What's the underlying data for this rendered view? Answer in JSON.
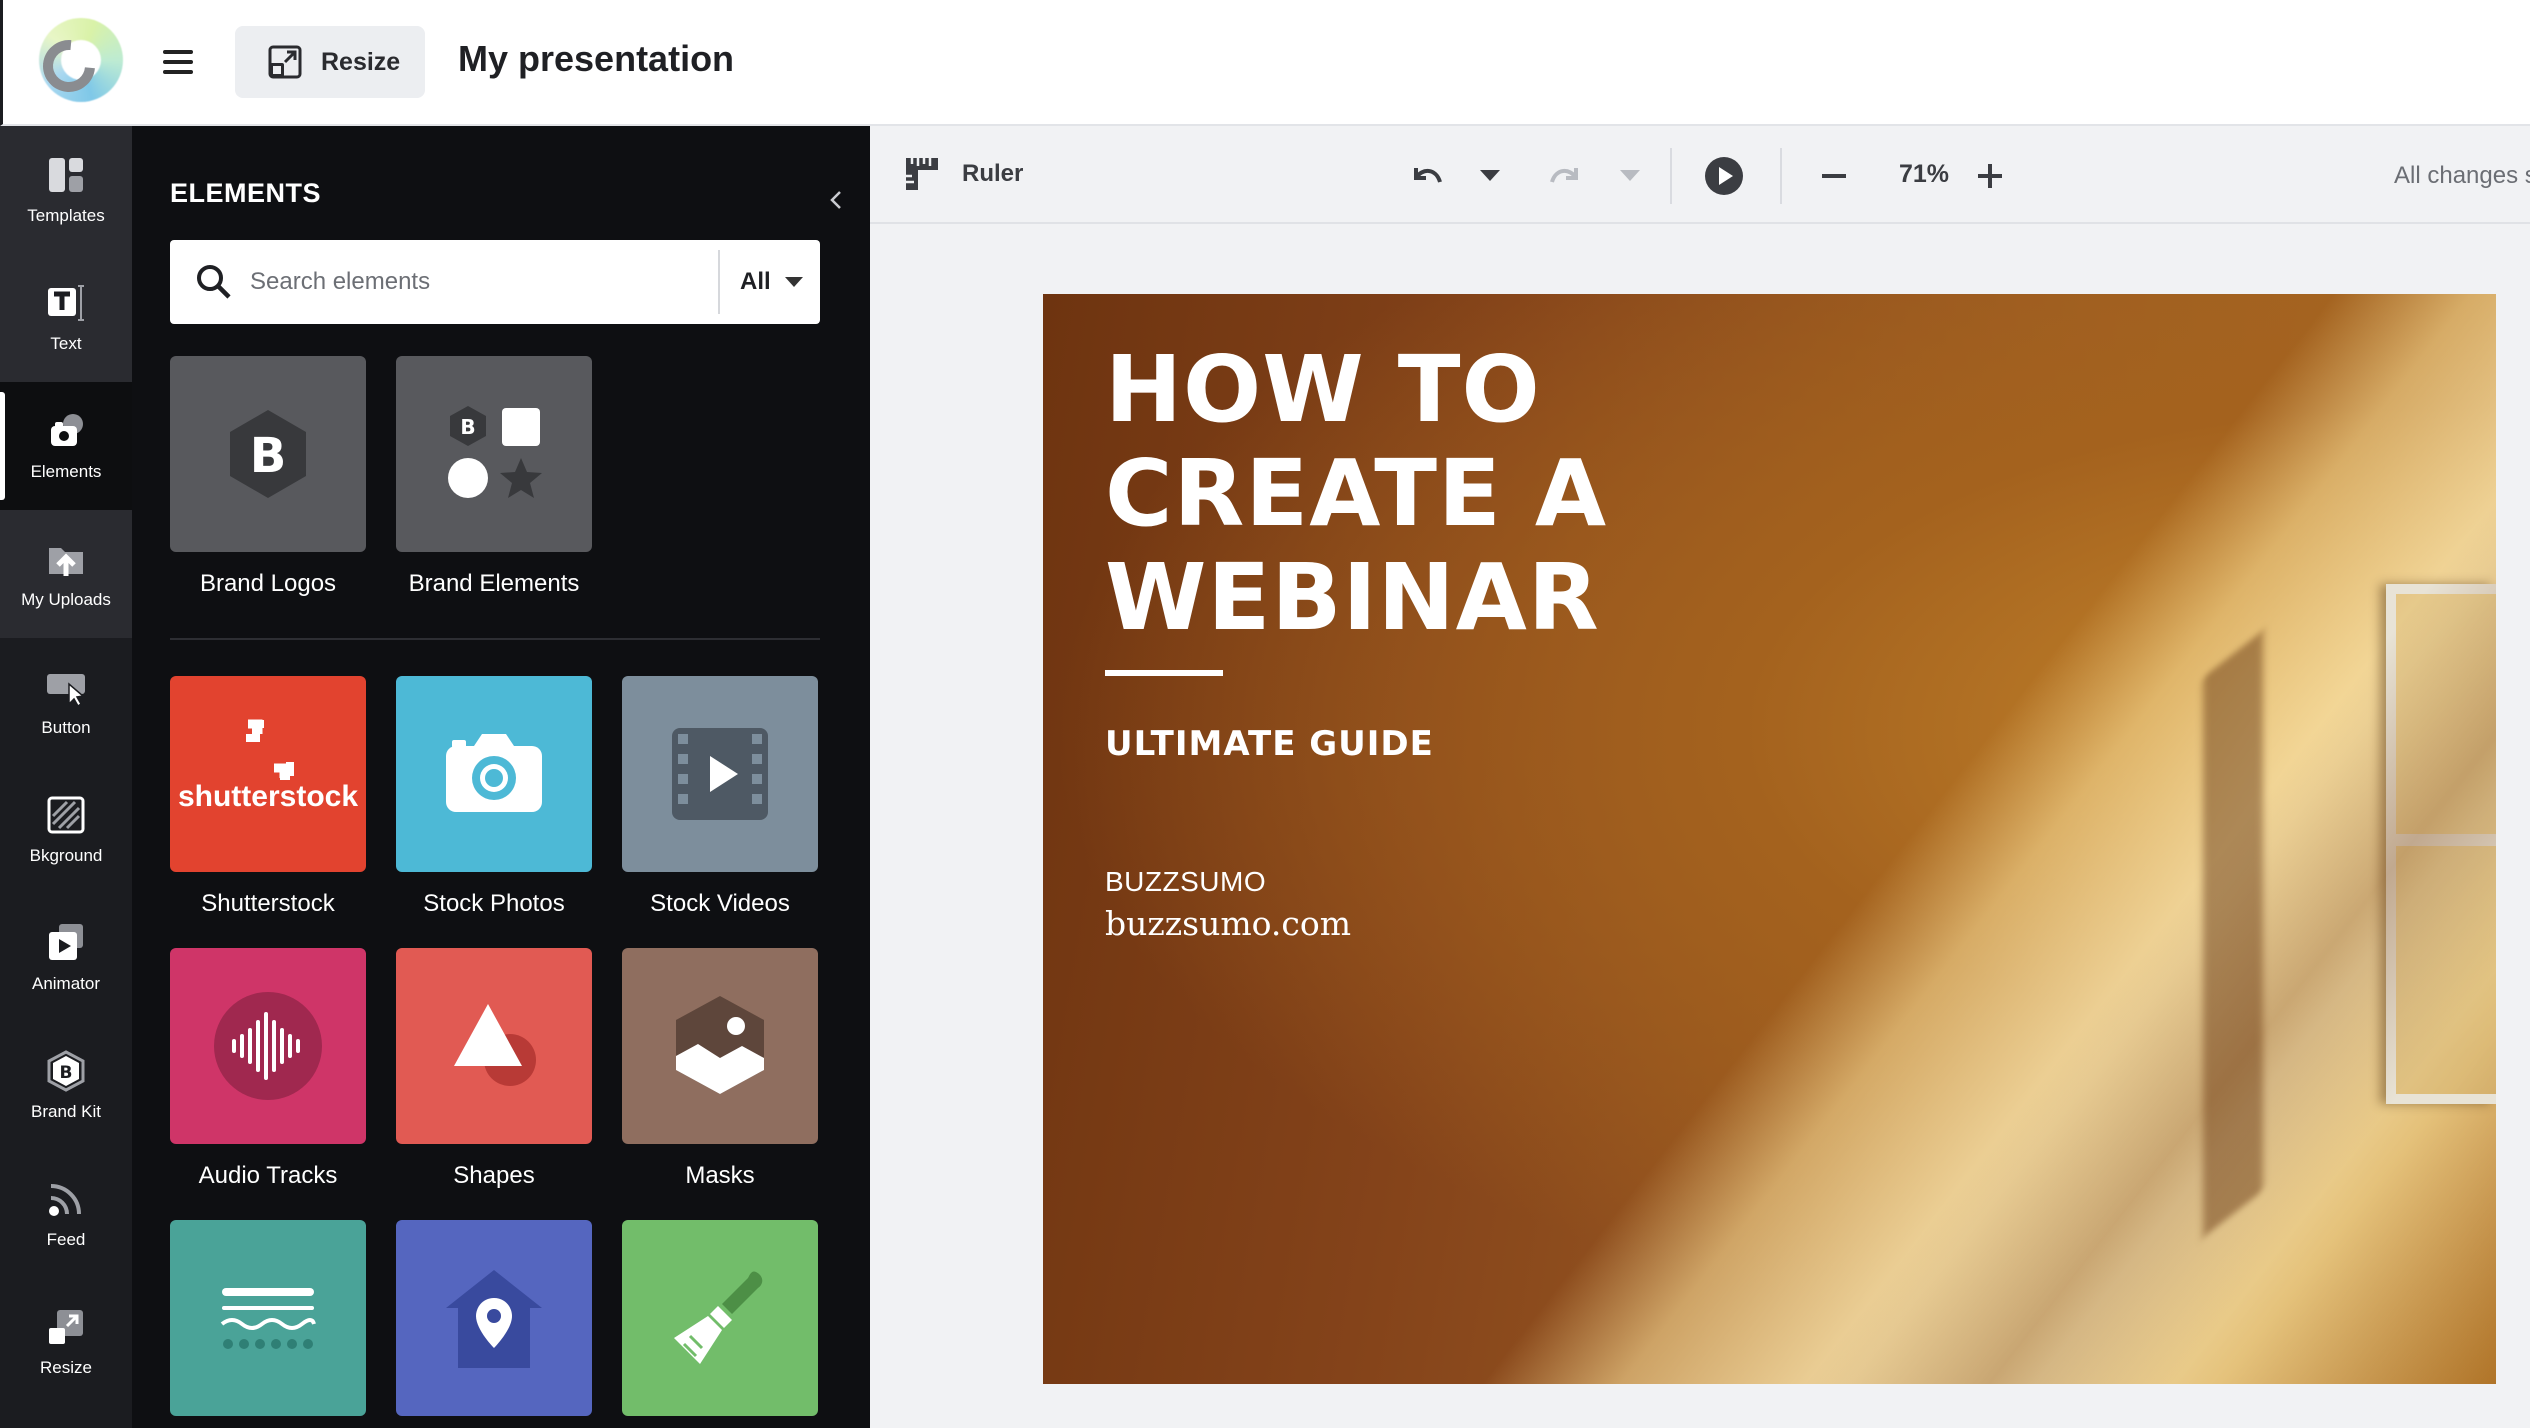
{
  "header": {
    "resize_label": "Resize",
    "doc_title": "My presentation"
  },
  "rail": {
    "items": [
      {
        "label": "Templates",
        "icon": "templates-icon"
      },
      {
        "label": "Text",
        "icon": "text-icon"
      },
      {
        "label": "Elements",
        "icon": "elements-icon",
        "active": true
      },
      {
        "label": "My Uploads",
        "icon": "upload-icon"
      },
      {
        "label": "Button",
        "icon": "button-icon"
      },
      {
        "label": "Bkground",
        "icon": "background-icon"
      },
      {
        "label": "Animator",
        "icon": "animator-icon"
      },
      {
        "label": "Brand Kit",
        "icon": "brand-kit-icon"
      },
      {
        "label": "Feed",
        "icon": "feed-icon"
      },
      {
        "label": "Resize",
        "icon": "resize-icon"
      }
    ]
  },
  "panel": {
    "title": "ELEMENTS",
    "search_placeholder": "Search elements",
    "filter_value": "All",
    "brand_tiles": [
      {
        "label": "Brand Logos",
        "color": "#58595d"
      },
      {
        "label": "Brand Elements",
        "color": "#58595d"
      }
    ],
    "tiles": [
      {
        "label": "Shutterstock",
        "color": "#e2432f"
      },
      {
        "label": "Stock Photos",
        "color": "#4db9d6"
      },
      {
        "label": "Stock Videos",
        "color": "#7d8e9c"
      },
      {
        "label": "Audio Tracks",
        "color": "#cf3568"
      },
      {
        "label": "Shapes",
        "color": "#e15a53"
      },
      {
        "label": "Masks",
        "color": "#8f6e5f"
      },
      {
        "label": "",
        "color": "#4aa398"
      },
      {
        "label": "",
        "color": "#5566bf"
      },
      {
        "label": "",
        "color": "#72bd6a"
      }
    ],
    "shutterstock_wordmark": "shutterstock"
  },
  "toolbar": {
    "ruler_label": "Ruler",
    "zoom": "71%",
    "save_status": "All changes s"
  },
  "slide": {
    "title": "HOW TO\nCREATE A\nWEBINAR",
    "subtitle": "ULTIMATE GUIDE",
    "brand": "BUZZSUMO",
    "url": "buzzsumo.com"
  }
}
